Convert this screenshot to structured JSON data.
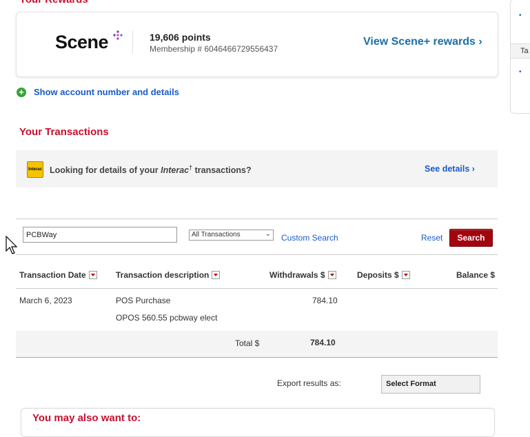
{
  "rewards": {
    "heading": "Your Rewards",
    "logo_text": "Scene",
    "logo_plus": "+",
    "points": "19,606 points",
    "membership": "Membership # 6046466729556437",
    "link": "View Scene+ rewards ›"
  },
  "account": {
    "show_details": "Show account number and details",
    "plus_icon": "+"
  },
  "transactions": {
    "heading": "Your Transactions",
    "interac": {
      "icon_text": "Interac",
      "text_before": "Looking for details of your ",
      "text_italic": "Interac",
      "text_dagger": "†",
      "text_after": " transactions?",
      "link": "See details ›"
    }
  },
  "search": {
    "value": "PCBWay",
    "type_selected": "All Transactions",
    "custom_search": "Custom Search",
    "reset": "Reset",
    "search_button": "Search"
  },
  "table": {
    "columns": [
      "Transaction Date",
      "Transaction description",
      "Withdrawals $",
      "Deposits $",
      "Balance $"
    ],
    "rows": [
      {
        "date": "March 6, 2023",
        "description_line1": "POS Purchase",
        "description_line2": "OPOS 560.55 pcbway elect",
        "withdrawal": "784.10",
        "deposit": "",
        "balance": ""
      }
    ],
    "total_label": "Total $",
    "total_value": "784.10"
  },
  "export": {
    "label": "Export results as:",
    "select": "Select Format"
  },
  "more": {
    "heading": "You may also want to:"
  },
  "side_panel": {
    "tab_label": "Ta"
  },
  "colors": {
    "brand_red": "#c8102e",
    "link_blue": "#1a5bc8",
    "search_button": "#a3050f"
  }
}
